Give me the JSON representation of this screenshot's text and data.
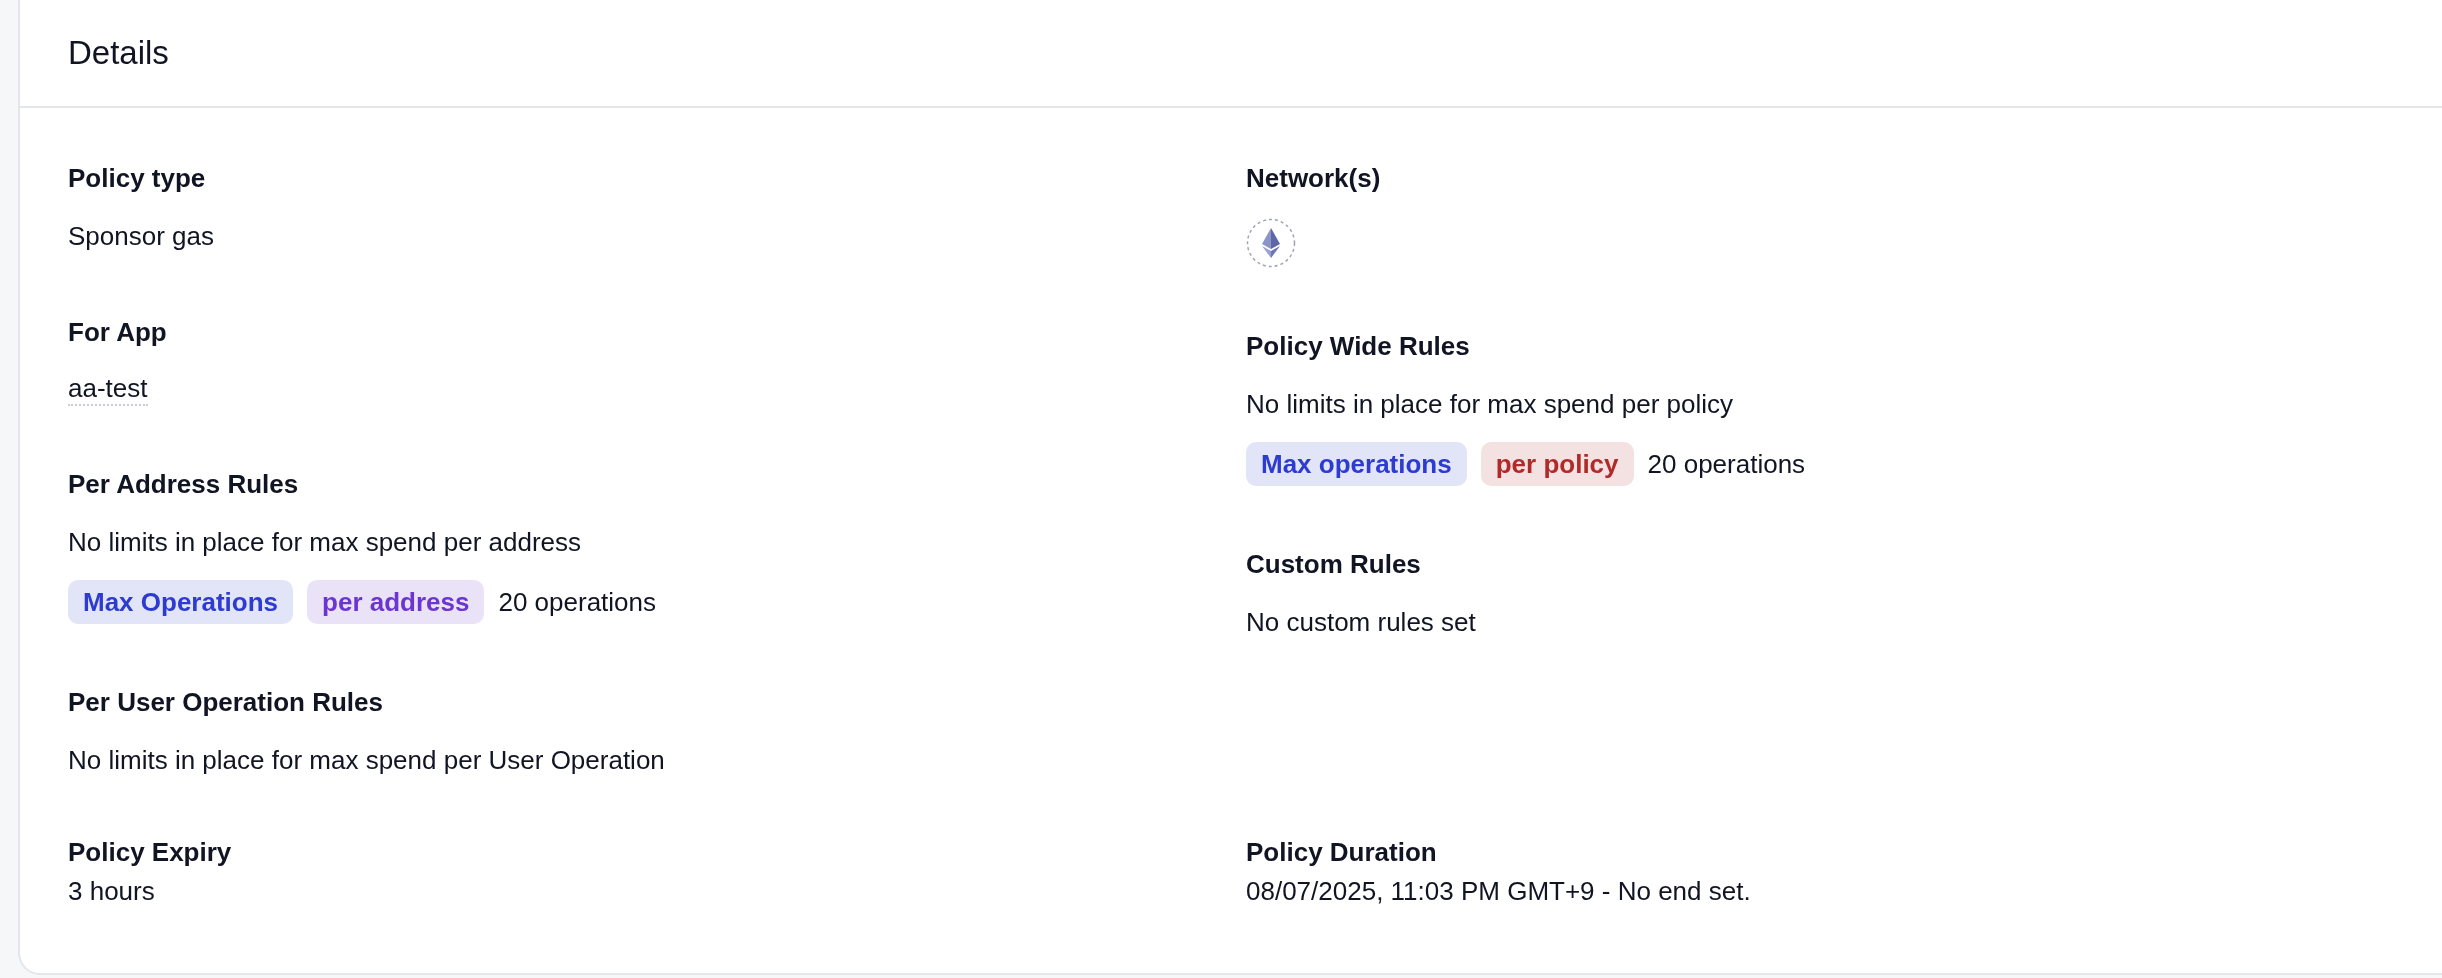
{
  "card": {
    "title": "Details"
  },
  "left": [
    {
      "label": "Policy type",
      "items": [
        {
          "kind": "text",
          "text": "Sponsor gas"
        }
      ]
    },
    {
      "label": "For App",
      "items": [
        {
          "kind": "link",
          "text": "aa-test"
        }
      ]
    },
    {
      "label": "Per Address Rules",
      "items": [
        {
          "kind": "text",
          "text": "No limits in place for max spend per address"
        },
        {
          "kind": "tags",
          "tags": [
            {
              "text": "Max Operations",
              "color": "#2d3bd0"
            },
            {
              "text": "per address",
              "color": "#6b35d0"
            }
          ],
          "text": "20 operations"
        }
      ]
    },
    {
      "label": "Per User Operation Rules",
      "items": [
        {
          "kind": "text",
          "text": "No limits in place for max spend per User Operation"
        }
      ]
    }
  ],
  "right": [
    {
      "label": "Network(s)",
      "items": [
        {
          "kind": "network"
        }
      ]
    },
    {
      "label": "Policy Wide Rules",
      "items": [
        {
          "kind": "text",
          "text": "No limits in place for max spend per policy"
        },
        {
          "kind": "tags",
          "tags": [
            {
              "text": "Max operations",
              "color": "#2d3bd0"
            },
            {
              "text": "per policy",
              "color": "#b02a2a"
            }
          ],
          "text": "20 operations"
        }
      ]
    },
    {
      "label": "Custom Rules",
      "items": [
        {
          "kind": "text",
          "text": "No custom rules set"
        }
      ]
    }
  ],
  "footer": [
    {
      "label": "Policy Expiry",
      "items": [
        {
          "kind": "text",
          "text": "3 hours"
        }
      ]
    },
    {
      "label": "Policy Duration",
      "items": [
        {
          "kind": "text",
          "text": "08/07/2025, 11:03 PM GMT+9 - No end set."
        }
      ]
    }
  ]
}
